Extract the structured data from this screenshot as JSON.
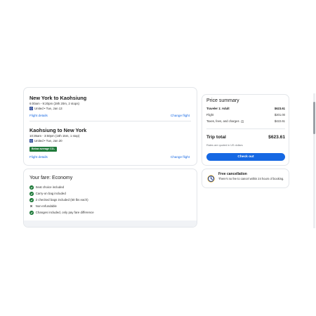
{
  "colors": {
    "accent": "#1668e3",
    "eco_badge": "#1f7a3a",
    "included_check": "#1f7a3a",
    "clock_yellow": "#f6c343"
  },
  "flights": [
    {
      "route": "New York to Kaohsiung",
      "times": "6:00am - 9:20pm (28h 20m, 2 stops)",
      "airline_date": "United • Tue, Jan 13",
      "details_link": "Flight details",
      "change_link": "Change flight",
      "icon": "airline-logo-icon"
    },
    {
      "route": "Kaohsiung to New York",
      "times": "10:35am - 3:50pm (18h 15m, 1 stop)",
      "airline_date": "United • Tue, Jan 20",
      "badge": "Below average CO₂",
      "details_link": "Flight details",
      "change_link": "Change flight",
      "icon": "airline-logo-icon"
    }
  ],
  "fare": {
    "title": "Your fare: Economy",
    "items": [
      {
        "text": "Seat choice included",
        "status": "included",
        "icon": "check-circle-icon"
      },
      {
        "text": "Carry-on bag included",
        "status": "included",
        "icon": "check-circle-icon"
      },
      {
        "text": "2 checked bags included (50 lbs each)",
        "status": "included",
        "icon": "check-circle-icon"
      },
      {
        "text": "Non-refundable",
        "status": "not-included",
        "icon": "x-icon"
      },
      {
        "text": "Changes included, only pay fare difference",
        "status": "included",
        "icon": "check-circle-icon"
      }
    ]
  },
  "price_summary": {
    "title": "Price summary",
    "traveler_label": "Traveler 1: Adult",
    "traveler_value": "$623.61",
    "flight_label": "Flight",
    "flight_value": "$201.00",
    "taxes_label": "Taxes, fees, and charges",
    "taxes_value": "$422.61",
    "total_label": "Trip total",
    "total_value": "$623.61",
    "note": "Rates are quoted in US dollars",
    "checkout_label": "Check out"
  },
  "cancellation": {
    "title": "Free cancellation",
    "text": "There's no fee to cancel within 24 hours of booking.",
    "icon": "clock-icon"
  }
}
